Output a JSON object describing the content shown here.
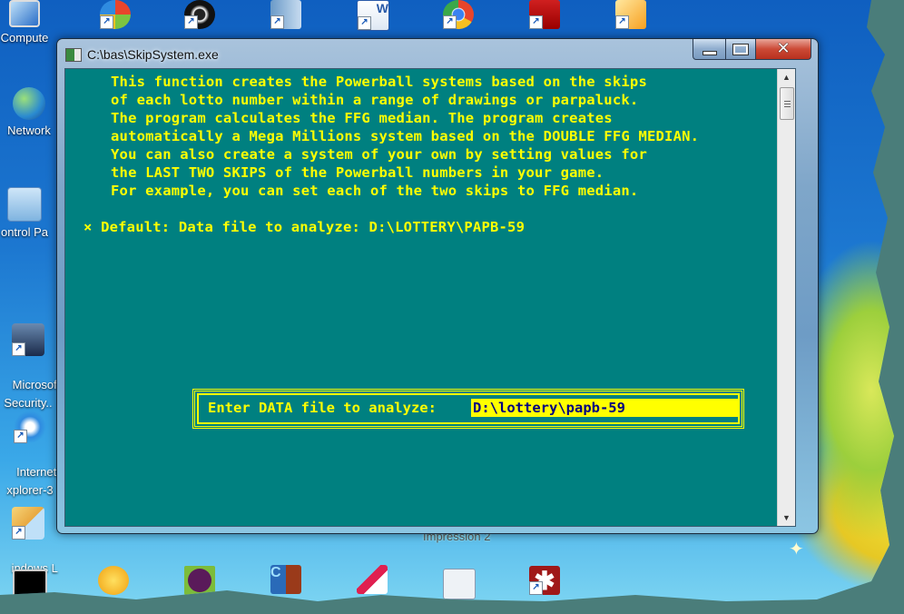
{
  "desktop": {
    "left_icons": [
      {
        "name": "computer",
        "label": "Compute"
      },
      {
        "name": "network",
        "label": "Network"
      },
      {
        "name": "control-panel",
        "label": "ontrol Pa"
      },
      {
        "name": "microsoft-security",
        "label": "Microsof\nSecurity.."
      },
      {
        "name": "internet-explorer",
        "label": "Internet\nxplorer-3"
      },
      {
        "name": "windows-live-mail",
        "label": "indows L\nMail"
      }
    ],
    "top_icons": [
      {
        "name": "windows-media-center",
        "icon": "windows-logo-icon"
      },
      {
        "name": "media-player",
        "icon": "media-player-icon"
      },
      {
        "name": "document-viewer",
        "icon": "document-icon"
      },
      {
        "name": "microsoft-word",
        "icon": "word-icon"
      },
      {
        "name": "google-chrome",
        "icon": "chrome-icon"
      },
      {
        "name": "adobe-reader",
        "icon": "acrobat-icon"
      },
      {
        "name": "image-tool",
        "icon": "image-icon"
      }
    ],
    "bottom_icons": [
      {
        "name": "command-prompt",
        "icon": "terminal-icon"
      },
      {
        "name": "settings-tool",
        "icon": "gears-icon"
      },
      {
        "name": "security-app",
        "icon": "lock-icon"
      },
      {
        "name": "c-app",
        "icon": "c-app-icon"
      },
      {
        "name": "paint-tool",
        "icon": "brush-icon"
      },
      {
        "name": "window-app",
        "icon": "window-icon"
      },
      {
        "name": "asterisk-app",
        "icon": "asterisk-icon"
      }
    ],
    "partial_label": "Impression 2",
    "shortcut_arrow": "↗"
  },
  "window": {
    "title": "C:\\bas\\SkipSystem.exe",
    "minimize_glyph": "",
    "close_glyph": "✕",
    "scroll_up": "▲",
    "scroll_down": "▼"
  },
  "console": {
    "lines": [
      "This function creates the Powerball systems based on the skips",
      "of each lotto number within a range of drawings or parpaluck.",
      "The program calculates the FFG median. The program creates",
      "automatically a Mega Millions system based on the DOUBLE FFG MEDIAN.",
      "You can also create a system of your own by setting values for",
      "the LAST TWO SKIPS of the Powerball numbers in your game.",
      "For example, you can set each of the two skips to FFG median."
    ],
    "default_line": "× Default: Data file to analyze: D:\\LOTTERY\\PAPB-59",
    "prompt_label": "Enter DATA file to analyze:",
    "prompt_value": "D:\\lottery\\papb-59"
  },
  "colors": {
    "console_bg": "#008080",
    "console_text": "#ffff00",
    "input_bg": "#ffff00",
    "input_text": "#000080"
  }
}
